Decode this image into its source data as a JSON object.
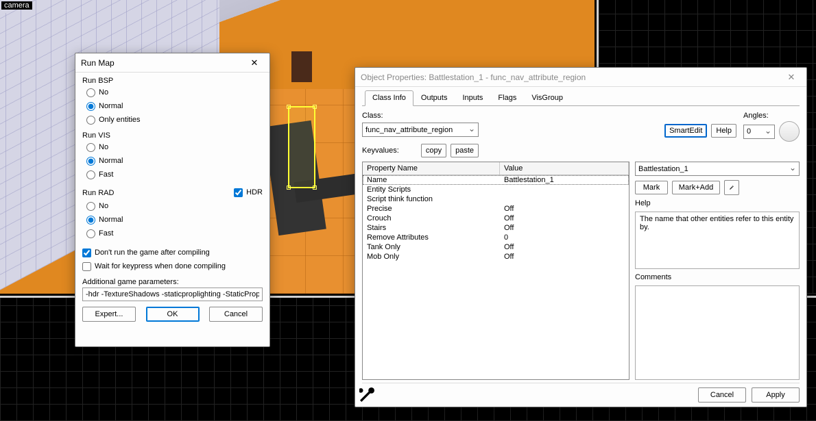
{
  "camera_label": "camera",
  "runmap": {
    "title": "Run Map",
    "groups": {
      "bsp": {
        "label": "Run BSP",
        "options": [
          "No",
          "Normal",
          "Only entities"
        ],
        "selected": "Normal"
      },
      "vis": {
        "label": "Run VIS",
        "options": [
          "No",
          "Normal",
          "Fast"
        ],
        "selected": "Normal"
      },
      "rad": {
        "label": "Run RAD",
        "options": [
          "No",
          "Normal",
          "Fast"
        ],
        "selected": "Normal",
        "hdr_label": "HDR",
        "hdr_checked": true
      }
    },
    "dont_run_label": "Don't run the game after compiling",
    "dont_run_checked": true,
    "wait_key_label": "Wait for keypress when done compiling",
    "wait_key_checked": false,
    "params_label": "Additional game parameters:",
    "params_value": "-hdr -TextureShadows -staticproplighting -StaticPropPoly",
    "btn_expert": "Expert...",
    "btn_ok": "OK",
    "btn_cancel": "Cancel"
  },
  "objprops": {
    "title": "Object Properties: Battlestation_1 - func_nav_attribute_region",
    "tabs": [
      "Class Info",
      "Outputs",
      "Inputs",
      "Flags",
      "VisGroup"
    ],
    "active_tab": "Class Info",
    "class_label": "Class:",
    "class_value": "func_nav_attribute_region",
    "keyvalues_label": "Keyvalues:",
    "btn_copy": "copy",
    "btn_paste": "paste",
    "btn_smartedit": "SmartEdit",
    "btn_help": "Help",
    "angles_label": "Angles:",
    "angles_value": "0",
    "table": {
      "head_name": "Property Name",
      "head_value": "Value",
      "rows": [
        {
          "name": "Name",
          "value": "Battlestation_1",
          "selected": true
        },
        {
          "name": "Entity Scripts",
          "value": ""
        },
        {
          "name": "Script think function",
          "value": ""
        },
        {
          "name": "Precise",
          "value": "Off"
        },
        {
          "name": "Crouch",
          "value": "Off"
        },
        {
          "name": "Stairs",
          "value": "Off"
        },
        {
          "name": "Remove Attributes",
          "value": "0"
        },
        {
          "name": "Tank Only",
          "value": "Off"
        },
        {
          "name": "Mob Only",
          "value": "Off"
        }
      ]
    },
    "name_field_value": "Battlestation_1",
    "btn_mark": "Mark",
    "btn_markadd": "Mark+Add",
    "help_label": "Help",
    "help_text": "The name that other entities refer to this entity by.",
    "comments_label": "Comments",
    "btn_cancel": "Cancel",
    "btn_apply": "Apply"
  }
}
